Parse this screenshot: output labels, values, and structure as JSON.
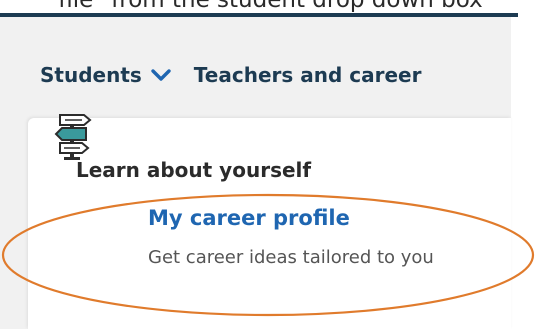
{
  "caption": {
    "text": "file\" from the student drop down box"
  },
  "nav": {
    "students_label": "Students",
    "teachers_label": "Teachers and career"
  },
  "dropdown": {
    "section_title": "Learn about yourself",
    "item": {
      "title": "My career profile",
      "description": "Get career ideas tailored to you",
      "icon": "signpost-icon"
    }
  },
  "colors": {
    "nav_text": "#1d3b52",
    "link": "#1f66b1",
    "highlight": "#e07b2c",
    "icon_teal": "#3a9a9c"
  }
}
